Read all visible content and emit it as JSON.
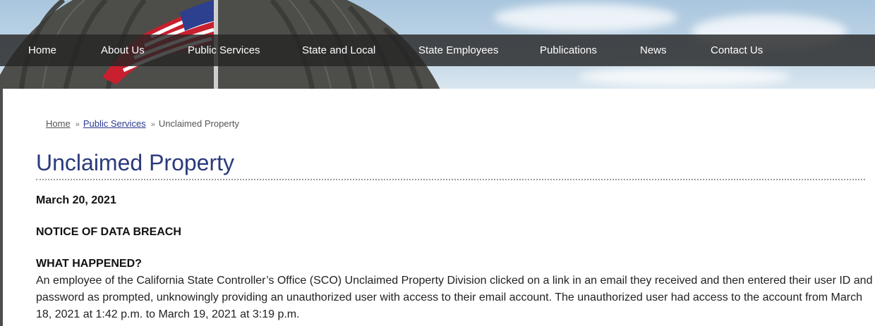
{
  "nav": {
    "items": [
      {
        "label": "Home"
      },
      {
        "label": "About Us"
      },
      {
        "label": "Public Services"
      },
      {
        "label": "State and Local"
      },
      {
        "label": "State Employees"
      },
      {
        "label": "Publications"
      },
      {
        "label": "News"
      },
      {
        "label": "Contact Us"
      }
    ]
  },
  "breadcrumb": {
    "home": "Home",
    "section": "Public Services",
    "current": "Unclaimed Property",
    "separator": "»"
  },
  "page": {
    "title": "Unclaimed Property",
    "date": "March 20, 2021",
    "notice_heading": "NOTICE OF DATA BREACH",
    "what_happened_heading": "WHAT HAPPENED?",
    "what_happened_body": "An employee of the California State Controller’s Office (SCO) Unclaimed Property Division clicked on a link in an email they received and then entered their user ID and password as prompted, unknowingly providing an unauthorized user with access to their email account. The unauthorized user had access to the account from March 18, 2021 at 1:42 p.m. to March 19, 2021 at 3:19 p.m."
  },
  "colors": {
    "title": "#2b3a7c",
    "link": "#2b3990",
    "nav_bg": "#262626"
  }
}
